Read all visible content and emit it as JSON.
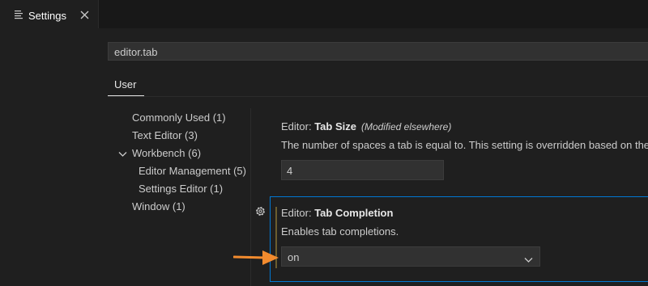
{
  "tab": {
    "label": "Settings",
    "icon": "settings-list-icon",
    "close_icon": "close-icon"
  },
  "search": {
    "value": "editor.tab"
  },
  "scope_tabs": [
    {
      "label": "User"
    }
  ],
  "toc": {
    "items": [
      {
        "label": "Commonly Used",
        "count": "(1)"
      },
      {
        "label": "Text Editor",
        "count": "(3)"
      },
      {
        "label": "Workbench",
        "count": "(6)",
        "expanded": true
      },
      {
        "label": "Editor Management",
        "count": "(5)"
      },
      {
        "label": "Settings Editor",
        "count": "(1)"
      },
      {
        "label": "Window",
        "count": "(1)"
      }
    ]
  },
  "settings": [
    {
      "category": "Editor: ",
      "name": "Tab Size",
      "modified": "(Modified elsewhere)",
      "description": "The number of spaces a tab is equal to. This setting is overridden based on the",
      "value": "4"
    },
    {
      "category": "Editor: ",
      "name": "Tab Completion",
      "description": "Enables tab completions.",
      "value": "on"
    }
  ],
  "colors": {
    "background": "#1f1f1f",
    "focus_border": "#0078d4",
    "arrow": "#f28b2e",
    "modified_indicator": "#6b5d2e"
  }
}
